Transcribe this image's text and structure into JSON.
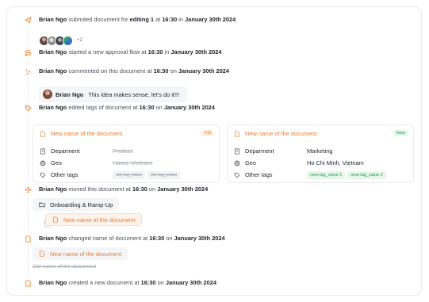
{
  "colors": {
    "accent": "#f07b2a",
    "new_green": "#2a9a4b",
    "old_orange": "#e07a22"
  },
  "events": {
    "submit": {
      "icon": "send-icon",
      "actor": "Brian Ngo",
      "text1": "submited document for",
      "text2": "editing 1",
      "text3": "at",
      "time": "16:30",
      "text4": "in",
      "date": "January 30th 2024",
      "more_count": "+2"
    },
    "approval": {
      "icon": "flow-icon",
      "actor": "Brian Ngo",
      "text1": "started a new approval flow at",
      "time": "16:30",
      "text2": "in",
      "date": "January 30th 2024"
    },
    "comment": {
      "icon": "comment-icon",
      "actor": "Brian Ngo",
      "text1": "commented on this document at",
      "time": "16:30",
      "text2": "on",
      "date": "January 30th 2024",
      "comment_author": "Brian Ngo",
      "comment_text": "This idea makes sense, let's do it!!!"
    },
    "tags": {
      "icon": "tag-icon",
      "actor": "Brian Ngo",
      "text1": "edited tags of document at",
      "time": "16:30",
      "text2": "on",
      "date": "January 30th 2024",
      "old": {
        "title": "New name of the document",
        "badge": "Old",
        "department_label": "Deparment",
        "department_value": "Product",
        "geo_label": "Geo",
        "geo_value": "Hanoi, Vietnam",
        "tags_label": "Other tags",
        "tags": [
          "old-tag_value",
          "old-tag_value"
        ]
      },
      "new": {
        "title": "New name of the document",
        "badge": "New",
        "department_label": "Deparment",
        "department_value": "Marketing",
        "geo_label": "Geo",
        "geo_value": "Ho Chi Minh, Vietnam",
        "tags_label": "Other tags",
        "tags": [
          "new-tag_value 1",
          "new-tag_value 2"
        ]
      }
    },
    "move": {
      "icon": "move-icon",
      "actor": "Brian Ngo",
      "text1": "moved this document at",
      "time": "16:30",
      "text2": "on",
      "date": "January 30th 2024",
      "folder": "Onboarding & Ramp-Up",
      "document": "New name of the document"
    },
    "rename": {
      "icon": "document-icon",
      "actor": "Brian Ngo",
      "text1": "changed name of document at",
      "time": "16:30",
      "text2": "on",
      "date": "January 30th 2024",
      "new_name": "New name of the document",
      "old_name": "Old name of the document"
    },
    "create": {
      "icon": "document-icon",
      "actor": "Brian Ngo",
      "text1": "created a new document at",
      "time": "16:30",
      "text2": "on",
      "date": "January 30th 2024"
    }
  }
}
